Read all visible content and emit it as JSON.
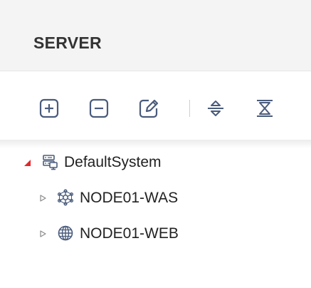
{
  "panel": {
    "title": "SERVER"
  },
  "toolbar": {
    "buttons": [
      {
        "icon": "plus-square-icon",
        "action": "add"
      },
      {
        "icon": "minus-square-icon",
        "action": "remove"
      },
      {
        "icon": "edit-icon",
        "action": "edit"
      },
      {
        "icon": "expand-all-icon",
        "action": "expand"
      },
      {
        "icon": "collapse-all-icon",
        "action": "collapse"
      }
    ]
  },
  "tree": {
    "root": {
      "label": "DefaultSystem",
      "expanded": true,
      "icon": "server-icon"
    },
    "children": [
      {
        "label": "NODE01-WAS",
        "expanded": false,
        "icon": "network-node-icon"
      },
      {
        "label": "NODE01-WEB",
        "expanded": false,
        "icon": "globe-icon"
      }
    ]
  },
  "colors": {
    "icon": "#4a5b7c",
    "accent": "#e0292c",
    "header_bg": "#f4f4f4"
  }
}
